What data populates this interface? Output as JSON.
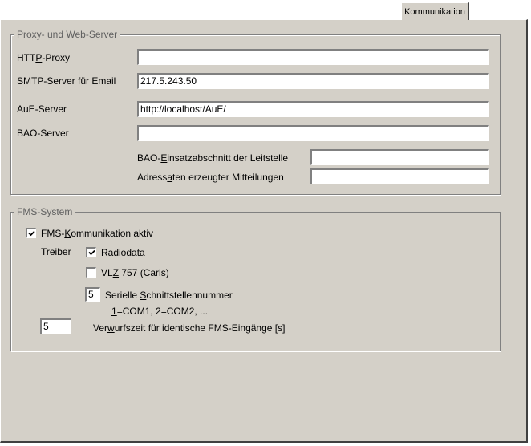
{
  "tab": {
    "label": "Kommunikation"
  },
  "proxy_group": {
    "legend": "Proxy- und Web-Server",
    "http_proxy": {
      "label_pre": "HTT",
      "label_ul": "P",
      "label_post": "-Proxy",
      "value": ""
    },
    "smtp_server": {
      "label": "SMTP-Server für Email",
      "value": "217.5.243.50"
    },
    "aue_server": {
      "label": "AuE-Server",
      "value": "http://localhost/AuE/"
    },
    "bao_server": {
      "label": "BAO-Server",
      "value": ""
    },
    "bao_einsatz": {
      "label_pre": "BAO-",
      "label_ul": "E",
      "label_post": "insatzabschnitt der Leitstelle",
      "value": ""
    },
    "adressaten": {
      "label_pre": "Adress",
      "label_ul": "a",
      "label_post": "ten erzeugter Mitteilungen",
      "value": ""
    }
  },
  "fms_group": {
    "legend": "FMS-System",
    "fms_aktiv": {
      "label_pre": "FMS-",
      "label_ul": "K",
      "label_post": "ommunikation aktiv",
      "checked": true
    },
    "treiber_label": "Treiber",
    "radiodata": {
      "label": "Radiodata",
      "checked": true
    },
    "vlz": {
      "label_pre": "VL",
      "label_ul": "Z",
      "label_post": " 757 (Carls)",
      "checked": false
    },
    "serial": {
      "value": "5",
      "label_pre": "Serielle ",
      "label_ul": "S",
      "label_post": "chnittstellennummer"
    },
    "serial_hint": {
      "ul": "1",
      "text": "=COM1,  2=COM2, ..."
    },
    "verwurf": {
      "value": "5",
      "label_pre": "Ver",
      "label_ul": "w",
      "label_post": "urfszeit für identische FMS-Eingänge [s]"
    }
  }
}
